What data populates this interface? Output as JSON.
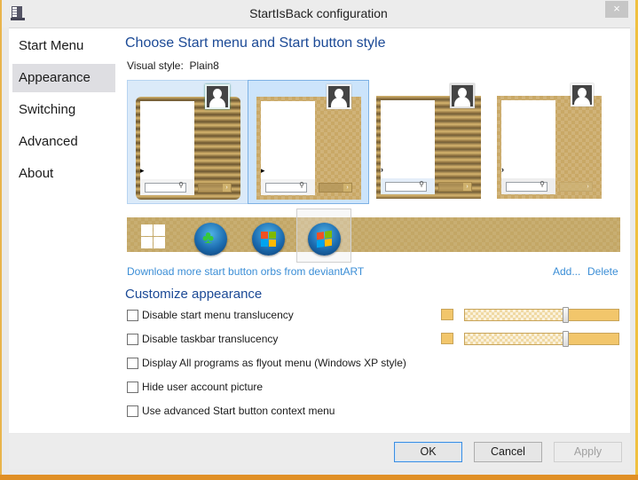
{
  "window": {
    "title": "StartIsBack configuration",
    "close_glyph": "×"
  },
  "sidebar": {
    "items": [
      {
        "label": "Start Menu",
        "active": false
      },
      {
        "label": "Appearance",
        "active": true
      },
      {
        "label": "Switching",
        "active": false
      },
      {
        "label": "Advanced",
        "active": false
      },
      {
        "label": "About",
        "active": false
      }
    ]
  },
  "main": {
    "heading": "Choose Start menu and Start button style",
    "visual_style_label": "Visual style:",
    "visual_style_value": "Plain8",
    "styles": [
      {
        "name": "style-gradient-rounded",
        "selected": "hover"
      },
      {
        "name": "style-plain8",
        "selected": "selected"
      },
      {
        "name": "style-gradient-square",
        "selected": "none"
      },
      {
        "name": "style-plain-square",
        "selected": "none"
      }
    ],
    "orbs": [
      {
        "name": "windows8-logo",
        "selected": false
      },
      {
        "name": "clover-orb",
        "selected": false
      },
      {
        "name": "windows-flag-orb",
        "selected": false
      },
      {
        "name": "windows7-orb",
        "selected": true
      }
    ],
    "download_link": "Download more start button orbs from deviantART",
    "add_link": "Add...",
    "delete_link": "Delete",
    "customize_heading": "Customize appearance",
    "options": [
      {
        "label": "Disable start menu translucency",
        "checked": false
      },
      {
        "label": "Disable taskbar translucency",
        "checked": false
      },
      {
        "label": "Display All programs as flyout menu (Windows XP style)",
        "checked": false
      },
      {
        "label": "Hide user account picture",
        "checked": false
      },
      {
        "label": "Use advanced Start button context menu",
        "checked": false
      }
    ],
    "translucency": {
      "start_menu": {
        "color": "#f2c66b",
        "opacity_percent": 66
      },
      "taskbar": {
        "color": "#f2c66b",
        "opacity_percent": 66
      }
    }
  },
  "footer": {
    "ok_label": "OK",
    "cancel_label": "Cancel",
    "apply_label": "Apply",
    "apply_enabled": false
  }
}
